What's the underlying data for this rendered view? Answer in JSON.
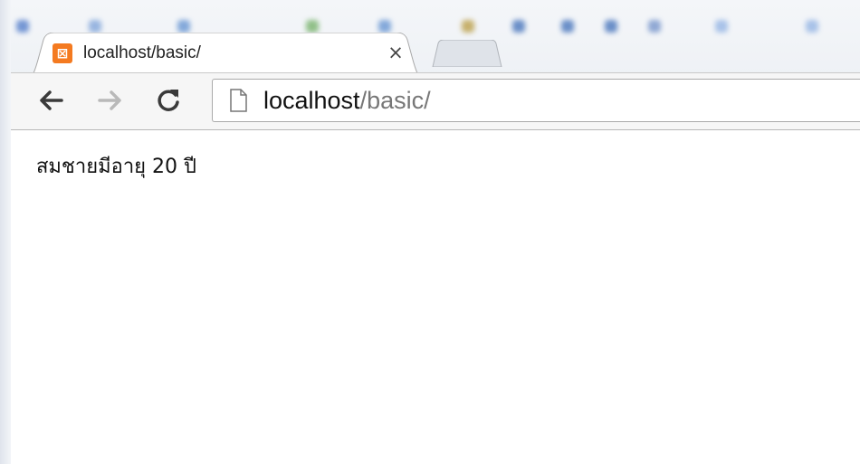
{
  "browser": {
    "tab": {
      "favicon_glyph": "⊠",
      "title": "localhost/basic/",
      "close_glyph": "×"
    },
    "toolbar": {
      "back_icon": "arrow-left-icon",
      "forward_icon": "arrow-right-icon",
      "reload_icon": "reload-icon"
    },
    "address_bar": {
      "page_icon": "page-icon",
      "host": "localhost",
      "path": "/basic/"
    }
  },
  "page": {
    "content_text": "สมชายมีอายุ 20 ปี"
  },
  "colors": {
    "favicon": "#f47a20",
    "tab_background": "#ffffff",
    "toolbar_background": "#f6f6f6",
    "url_host": "#111111",
    "url_path": "#777777"
  }
}
